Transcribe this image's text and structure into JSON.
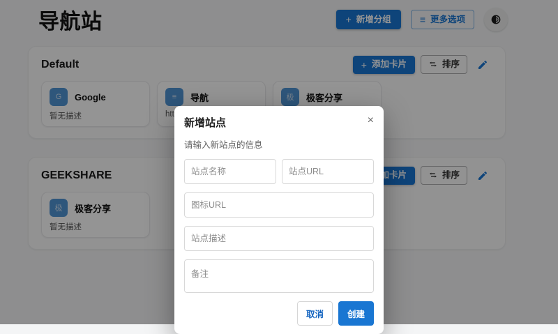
{
  "page": {
    "title": "导航站",
    "header": {
      "plus_glyph": "+",
      "add_group_label": "新增分组",
      "menu_glyph": "≡",
      "more_options_label": "更多选项"
    },
    "groups": [
      {
        "name": "Default",
        "add_card_label": "添加卡片",
        "sort_label": "排序",
        "plus_glyph": "+",
        "cards": [
          {
            "title": "Google",
            "desc": "暂无描述",
            "icon_glyph": "G"
          },
          {
            "title": "导航",
            "desc": "https://navihive.xingqiong.i",
            "icon_glyph": "≡"
          },
          {
            "title": "极客分享",
            "desc": "暂无描述",
            "icon_glyph": "极"
          }
        ]
      },
      {
        "name": "GEEKSHARE",
        "add_card_label": "添加卡片",
        "sort_label": "排序",
        "plus_glyph": "+",
        "cards": [
          {
            "title": "极客分享",
            "desc": "暂无描述",
            "icon_glyph": "极"
          }
        ]
      }
    ]
  },
  "modal": {
    "title": "新增站点",
    "subtitle": "请输入新站点的信息",
    "close_glyph": "×",
    "fields": {
      "name_placeholder": "站点名称",
      "url_placeholder": "站点URL",
      "icon_url_placeholder": "图标URL",
      "desc_placeholder": "站点描述",
      "note_placeholder": "备注"
    },
    "cancel_label": "取消",
    "create_label": "创建"
  },
  "colors": {
    "primary": "#1976d2",
    "card_icon_bg": "#5094d5",
    "backdrop": "rgba(0,0,0,0.42)"
  }
}
